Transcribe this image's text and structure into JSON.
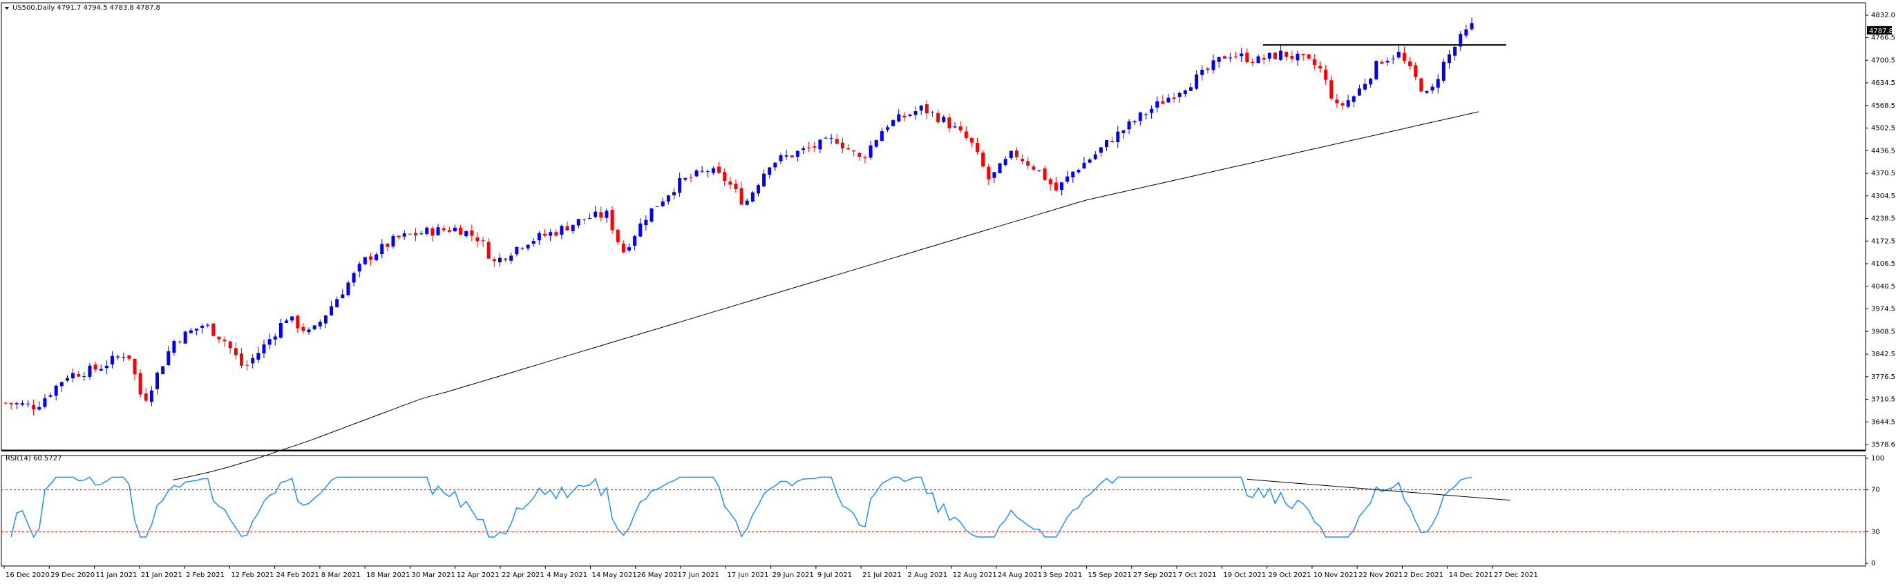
{
  "header": {
    "symbol_line": "US500,Daily  4791.7 4794.5 4783.8 4787.8",
    "rsi_line": "RSI(14) 60.5727"
  },
  "chart_data": [
    {
      "type": "candlestick",
      "title": "US500,Daily",
      "ohlc_last": {
        "open": 4791.7,
        "high": 4794.5,
        "low": 4783.8,
        "close": 4787.8
      },
      "current_price_label": "4787.8",
      "ylim": [
        3578.6,
        4832.0
      ],
      "y_ticks": [
        "4832.0",
        "4766.5",
        "4700.5",
        "4634.5",
        "4568.5",
        "4502.5",
        "4436.5",
        "4370.5",
        "4304.5",
        "4238.5",
        "4172.5",
        "4106.5",
        "4040.5",
        "3974.5",
        "3908.5",
        "3842.5",
        "3776.5",
        "3710.5",
        "3644.5",
        "3578.6"
      ],
      "y_tick_values": [
        4832.0,
        4766.5,
        4700.5,
        4634.5,
        4568.5,
        4502.5,
        4436.5,
        4370.5,
        4304.5,
        4238.5,
        4172.5,
        4106.5,
        4040.5,
        3974.5,
        3908.5,
        3842.5,
        3776.5,
        3710.5,
        3644.5,
        3578.6
      ],
      "x_labels": [
        "16 Dec 2020",
        "29 Dec 2020",
        "11 Jan 2021",
        "21 Jan 2021",
        "2 Feb 2021",
        "12 Feb 2021",
        "24 Feb 2021",
        "8 Mar 2021",
        "18 Mar 2021",
        "30 Mar 2021",
        "12 Apr 2021",
        "22 Apr 2021",
        "4 May 2021",
        "14 May 2021",
        "26 May 2021",
        "7 Jun 2021",
        "17 Jun 2021",
        "29 Jun 2021",
        "9 Jul 2021",
        "21 Jul 2021",
        "2 Aug 2021",
        "12 Aug 2021",
        "24 Aug 2021",
        "3 Sep 2021",
        "15 Sep 2021",
        "27 Sep 2021",
        "7 Oct 2021",
        "19 Oct 2021",
        "29 Oct 2021",
        "10 Nov 2021",
        "22 Nov 2021",
        "2 Dec 2021",
        "14 Dec 2021",
        "27 Dec 2021"
      ],
      "colors": {
        "up": "#0000ff",
        "down": "#ff0000",
        "ma": "#000000",
        "grid": "#000000"
      },
      "ma_series": {
        "name": "",
        "values": [
          3475,
          3480,
          3486,
          3492,
          3498,
          3505,
          3512,
          3520,
          3528,
          3536,
          3545,
          3554,
          3563,
          3572,
          3581,
          3590,
          3600,
          3610,
          3620,
          3630,
          3640,
          3650,
          3660,
          3670,
          3680,
          3690,
          3700,
          3710,
          3718,
          3725,
          3732,
          3740,
          3748,
          3756,
          3764,
          3772,
          3780,
          3788,
          3796,
          3804,
          3812,
          3820,
          3828,
          3836,
          3844,
          3852,
          3860,
          3868,
          3876,
          3884,
          3892,
          3900,
          3908,
          3916,
          3924,
          3932,
          3940,
          3948,
          3956,
          3964,
          3972,
          3980,
          3988,
          3996,
          4004,
          4012,
          4020,
          4028,
          4036,
          4044,
          4052,
          4060,
          4068,
          4076,
          4084,
          4092,
          4100,
          4108,
          4116,
          4124,
          4132,
          4140,
          4148,
          4156,
          4164,
          4172,
          4180,
          4188,
          4196,
          4204,
          4212,
          4220,
          4228,
          4236,
          4244,
          4252,
          4260,
          4268,
          4276,
          4284,
          4292,
          4298,
          4304,
          4310,
          4316,
          4322,
          4328,
          4334,
          4340,
          4346,
          4352,
          4358,
          4364,
          4370,
          4376,
          4382,
          4388,
          4394,
          4400,
          4406,
          4412,
          4418,
          4424,
          4430,
          4436,
          4442,
          4448,
          4454,
          4460,
          4466,
          4472,
          4478,
          4484,
          4490,
          4496,
          4502,
          4508,
          4514,
          4520,
          4526,
          4532,
          4538,
          4544,
          4550
        ]
      },
      "trend_lines": [
        {
          "from_index": 260,
          "to_index": 311,
          "y1": 4745,
          "y2": 4745
        },
        {
          "from_index": 311,
          "to_index": 311,
          "y1": 4745,
          "y2": 4745
        }
      ],
      "candle_count": 262
    },
    {
      "type": "line",
      "title": "RSI(14) 60.5727",
      "ylim": [
        0,
        100
      ],
      "y_ticks": [
        "100",
        "70",
        "30",
        "0"
      ],
      "y_tick_values": [
        100,
        70,
        30,
        0
      ],
      "levels": [
        70,
        30
      ],
      "colors": {
        "line": "#1e90ff",
        "level": "#ff0000",
        "trend": "#000000"
      }
    }
  ]
}
